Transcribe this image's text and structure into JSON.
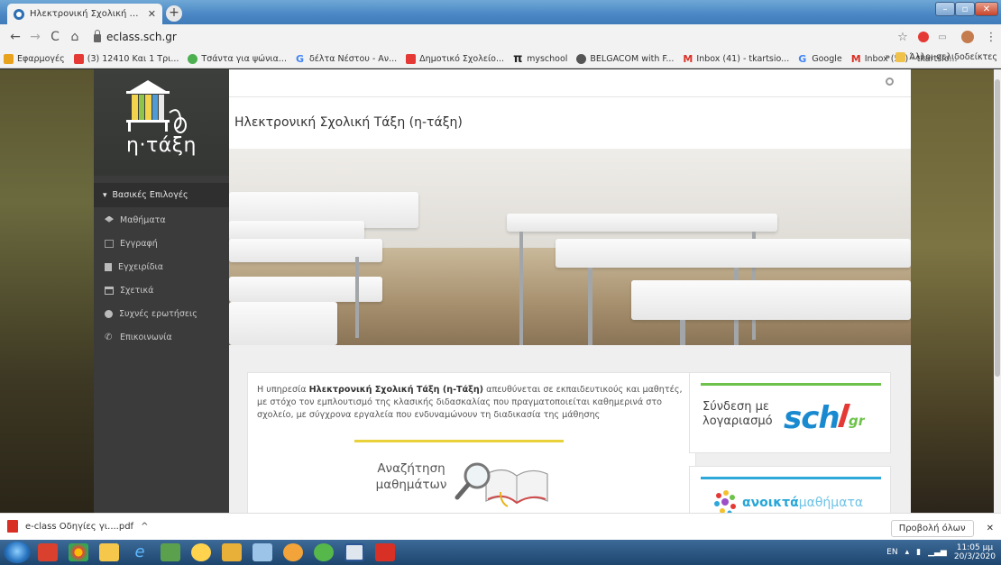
{
  "browser": {
    "tab_title": "Ηλεκτρονική Σχολική Τάξη (η-Τά",
    "tab_close": "✕",
    "new_tab": "+",
    "url": "eclass.sch.gr",
    "bookmarks": [
      {
        "label": "Εφαρμογές",
        "color": "#e8a21b"
      },
      {
        "label": "(3) 12410 Και 1 Τρι...",
        "color": "#e53935"
      },
      {
        "label": "Τσάντα για ψώνια...",
        "color": "#4caf50"
      },
      {
        "label": "δέλτα Νέστου - Αν...",
        "color": "#4285f4"
      },
      {
        "label": "Δημοτικό Σχολείο...",
        "color": "#e53935"
      },
      {
        "label": "myschool",
        "color": "#222222"
      },
      {
        "label": "BELGACOM with F...",
        "color": "#555555"
      },
      {
        "label": "Inbox (41) - tkartsio...",
        "color": "#d93025"
      },
      {
        "label": "Google",
        "color": "#4285f4"
      },
      {
        "label": "Inbox (55) - tkartsio...",
        "color": "#d93025"
      }
    ],
    "bookmarks_more": "»",
    "other_bookmarks": "Άλλοι σελιδοδείκτες"
  },
  "sidebar": {
    "logo_text": "η·τάξη",
    "menu_header": "Βασικές Επιλογές",
    "items": [
      {
        "label": "Μαθήματα",
        "icon": "graduation-cap-icon"
      },
      {
        "label": "Εγγραφή",
        "icon": "edit-icon"
      },
      {
        "label": "Εγχειρίδια",
        "icon": "file-icon"
      },
      {
        "label": "Σχετικά",
        "icon": "card-icon"
      },
      {
        "label": "Συχνές ερωτήσεις",
        "icon": "question-icon"
      },
      {
        "label": "Επικοινωνία",
        "icon": "phone-icon"
      }
    ]
  },
  "main": {
    "title": "Ηλεκτρονική Σχολική Τάξη (η-τάξη)",
    "info_prefix": "Η υπηρεσία ",
    "info_bold": "Ηλεκτρονική Σχολική Τάξη (η-Τάξη)",
    "info_rest": " απευθύνεται σε εκπαιδευτικούς και μαθητές, με στόχο τον εμπλουτισμό της κλασικής διδασκαλίας που πραγματοποιείται καθημερινά στο σχολείο, με σύγχρονα εργαλεία που ενδυναμώνουν τη διαδικασία της μάθησης",
    "search_line1": "Αναζήτηση",
    "search_line2": "μαθημάτων",
    "sch_line1": "Σύνδεση με",
    "sch_line2": "λογαριασμό",
    "sch_logo": "sch",
    "ao_bold": "ανοικτά",
    "ao_rest": "μαθήματα"
  },
  "downloads": {
    "file": "e-class Οδηγίες γι....pdf",
    "expand": "^",
    "show_all": "Προβολή όλων",
    "close": "✕"
  },
  "taskbar": {
    "lang": "EN",
    "time": "11:05 μμ",
    "date": "20/3/2020"
  }
}
